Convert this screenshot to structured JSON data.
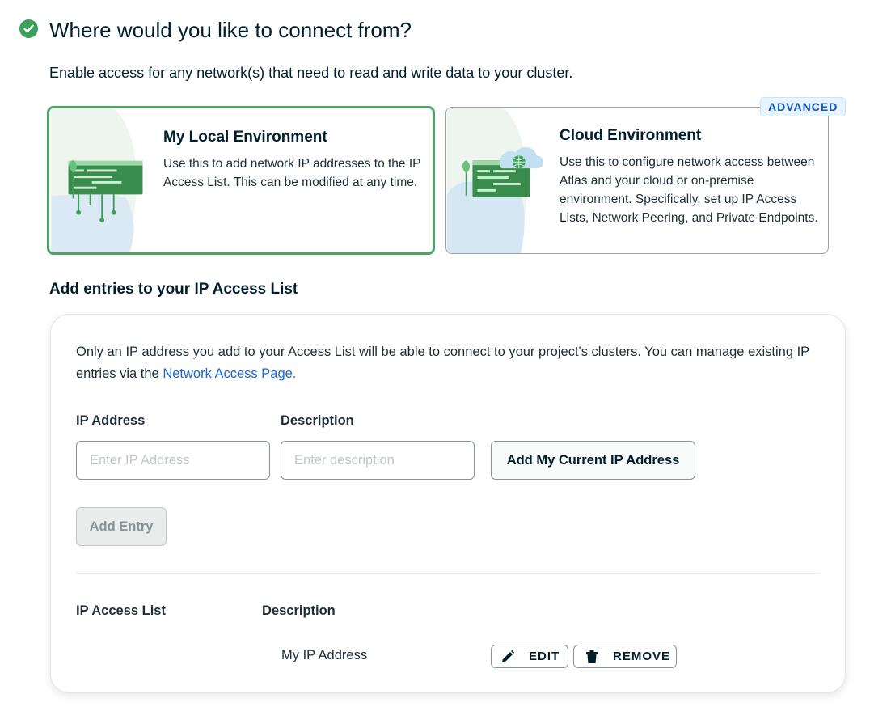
{
  "header": {
    "title": "Where would you like to connect from?"
  },
  "subtitle": "Enable access for any network(s) that need to read and write data to your cluster.",
  "environments": {
    "local": {
      "title": "My Local Environment",
      "description": "Use this to add network IP addresses to the IP Access List. This can be modified at any time.",
      "selected": true
    },
    "cloud": {
      "badge": "ADVANCED",
      "title": "Cloud Environment",
      "description": "Use this to configure network access between Atlas and your cloud or on-premise environment. Specifically, set up IP Access Lists, Network Peering, and Private Endpoints.",
      "selected": false
    }
  },
  "access_list": {
    "section_title": "Add entries to your IP Access List",
    "info_text": "Only an IP address you add to your Access List will be able to connect to your project's clusters. You can manage existing IP entries via the ",
    "info_link": "Network Access Page.",
    "ip_label": "IP Address",
    "ip_placeholder": "Enter IP Address",
    "ip_value": "",
    "desc_label": "Description",
    "desc_placeholder": "Enter description",
    "desc_value": "",
    "add_current_ip_label": "Add My Current IP Address",
    "add_entry_label": "Add Entry",
    "list_header": "IP Access List",
    "desc_header": "Description",
    "rows": [
      {
        "ip": "",
        "description": "My IP Address",
        "edit_label": "EDIT",
        "remove_label": "REMOVE"
      }
    ]
  },
  "colors": {
    "accent_green": "#4aa564",
    "check_green": "#3d9f5b",
    "link_blue": "#1a66d6",
    "badge_blue": "#1254b7"
  },
  "icons": {
    "header": "check-circle-icon",
    "edit": "pencil-icon",
    "remove": "trash-icon"
  }
}
